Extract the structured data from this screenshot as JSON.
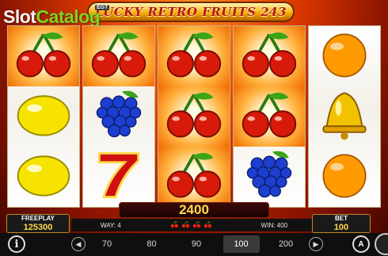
{
  "game": {
    "title": "LUCKY RETRO FRUITS 243",
    "watermark_main": "Slot",
    "watermark_accent": "Catalog",
    "provider_badge": "EGT"
  },
  "reels": [
    [
      "cherry",
      "lemon",
      "lemon"
    ],
    [
      "cherry",
      "grapes",
      "seven"
    ],
    [
      "cherry",
      "cherry",
      "cherry"
    ],
    [
      "cherry",
      "cherry",
      "grapes"
    ],
    [
      "orange",
      "bell",
      "orange"
    ]
  ],
  "winning_cells": [
    [
      0,
      0
    ],
    [
      1,
      0
    ],
    [
      2,
      0
    ],
    [
      2,
      1
    ],
    [
      2,
      2
    ],
    [
      3,
      0
    ],
    [
      3,
      1
    ]
  ],
  "win": {
    "amount": "2400",
    "way_label": "WAY: 4",
    "win_label": "WIN: 400",
    "symbol_icons": [
      "cherry",
      "cherry",
      "cherry",
      "cherry"
    ]
  },
  "freeplay": {
    "label": "FREEPLAY",
    "value": "125300"
  },
  "bet": {
    "label": "BET",
    "value": "100"
  },
  "bet_options": [
    "70",
    "80",
    "90",
    "100",
    "200"
  ],
  "selected_bet": "100",
  "controls": {
    "info": "i",
    "auto": "A"
  },
  "colors": {
    "cherry": "#d81a0a",
    "lemon": "#f6e400",
    "orange": "#ff9a00",
    "grapes": "#1d3fd0",
    "bell": "#f2c200",
    "seven": "#d01010",
    "gold_text": "#ffd84a"
  }
}
